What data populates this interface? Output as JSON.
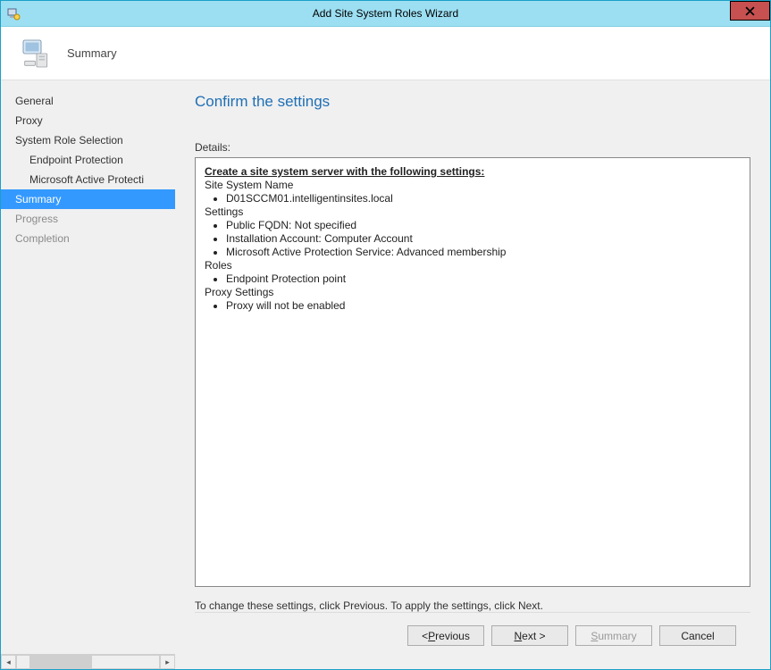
{
  "window": {
    "title": "Add Site System Roles Wizard"
  },
  "header": {
    "step_title": "Summary"
  },
  "sidebar": {
    "items": [
      {
        "label": "General",
        "sub": false
      },
      {
        "label": "Proxy",
        "sub": false
      },
      {
        "label": "System Role Selection",
        "sub": false
      },
      {
        "label": "Endpoint Protection",
        "sub": true
      },
      {
        "label": "Microsoft Active Protecti",
        "sub": true
      },
      {
        "label": "Summary",
        "sub": false,
        "selected": true
      },
      {
        "label": "Progress",
        "sub": false,
        "disabled": true
      },
      {
        "label": "Completion",
        "sub": false,
        "disabled": true
      }
    ]
  },
  "main": {
    "page_title": "Confirm the settings",
    "details_label": "Details:",
    "details": {
      "heading": "Create a site system server with the following settings:",
      "site_system_name_label": "Site System Name",
      "site_system_name_items": [
        "D01SCCM01.intelligentinsites.local"
      ],
      "settings_label": "Settings",
      "settings_items": [
        "Public FQDN: Not specified",
        "Installation Account: Computer Account",
        "Microsoft Active Protection Service: Advanced membership"
      ],
      "roles_label": "Roles",
      "roles_items": [
        "Endpoint Protection point"
      ],
      "proxy_label": "Proxy Settings",
      "proxy_items": [
        "Proxy will not be enabled"
      ]
    },
    "hint": "To change these settings, click Previous. To apply the settings, click Next."
  },
  "footer": {
    "previous_prefix": "< ",
    "previous_u": "P",
    "previous_rest": "revious",
    "next_u": "N",
    "next_rest": "ext >",
    "summary_u": "S",
    "summary_rest": "ummary",
    "cancel": "Cancel"
  }
}
